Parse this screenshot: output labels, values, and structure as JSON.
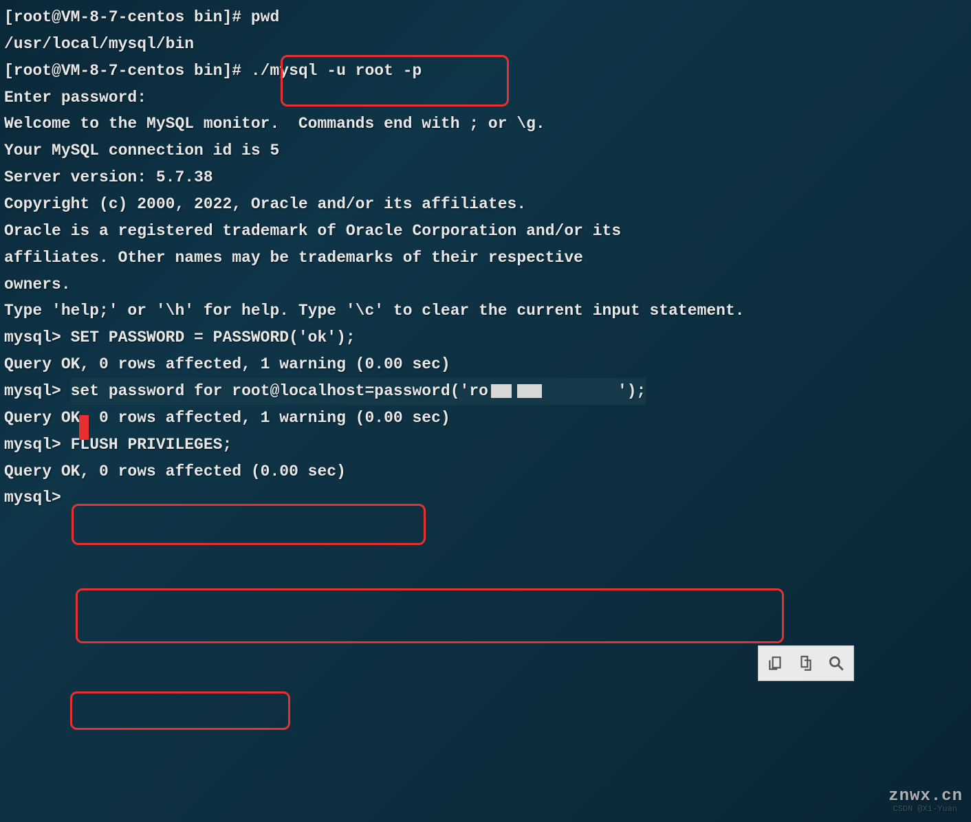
{
  "lines": {
    "l1_prompt": "[root@VM-8-7-centos bin]# ",
    "l1_cmd": "pwd",
    "l2": "/usr/local/mysql/bin",
    "l3_prompt": "[root@VM-8-7-centos bin]# ",
    "l3_cmd": "./mysql -u root -p",
    "l4": "Enter password: ",
    "l5": "Welcome to the MySQL monitor.  Commands end with ; or \\g.",
    "l6": "Your MySQL connection id is 5",
    "l7": "Server version: 5.7.38",
    "l8": "",
    "l9": "Copyright (c) 2000, 2022, Oracle and/or its affiliates.",
    "l10": "",
    "l11": "Oracle is a registered trademark of Oracle Corporation and/or its",
    "l12": "affiliates. Other names may be trademarks of their respective",
    "l13": "owners.",
    "l14": "",
    "l15": "Type 'help;' or '\\h' for help. Type '\\c' to clear the current input statement.",
    "l16": "",
    "l17_prompt": "mysql> ",
    "l17_cmd": "SET PASSWORD = PASSWORD('ok');",
    "l18": "Query OK, 0 rows affected, 1 warning (0.00 sec)",
    "l19": "",
    "l20_prompt": "mysql> ",
    "l20_cmd_a": "set password for root@localhost=password('ro",
    "l20_cmd_b": "');",
    "l21": "Query OK, 0 rows affected, 1 warning (0.00 sec)",
    "l22": "",
    "l23_prompt": "mysql> ",
    "l23_cmd": "FLUSH PRIVILEGES;",
    "l24": "Query OK, 0 rows affected (0.00 sec)",
    "l25": "",
    "l26_prompt": "mysql> "
  },
  "watermark": {
    "znwx": "znwx.cn",
    "csdn": "CSDN @Xi-Yuan"
  }
}
